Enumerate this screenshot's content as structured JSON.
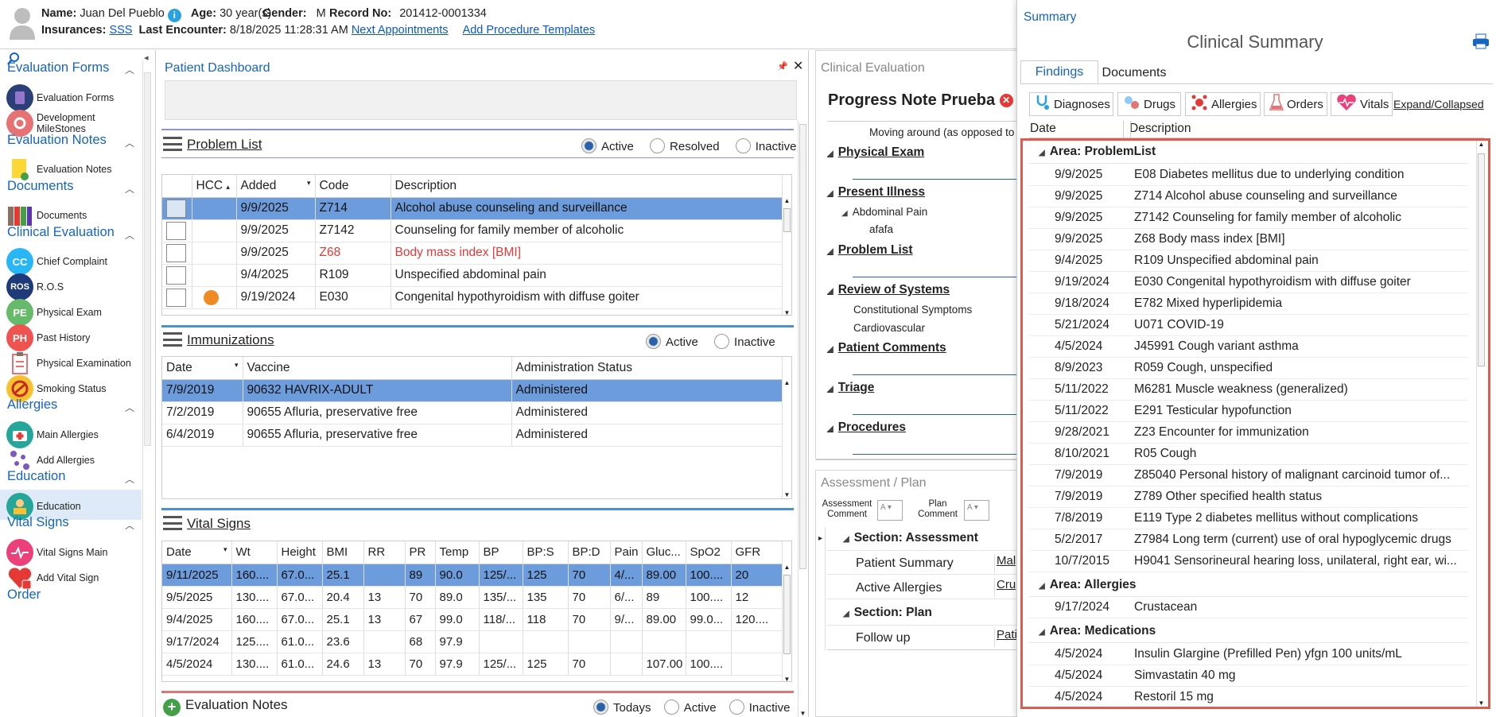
{
  "header": {
    "name_label": "Name:",
    "name": "Juan Del Pueblo",
    "age_label": "Age:",
    "age": "30 year(s)",
    "gender_label": "Gender:",
    "gender": "M",
    "record_label": "Record No:",
    "record": "201412-0001334",
    "insurances_label": "Insurances:",
    "insurance": "SSS",
    "last_encounter_label": "Last Encounter:",
    "last_encounter": "8/18/2025 11:28:31 AM",
    "next_appointments": "Next Appointments",
    "add_procedure_templates": "Add Procedure Templates"
  },
  "sidebar": {
    "sections": [
      {
        "title": "Evaluation Forms",
        "items": [
          "Evaluation Forms",
          "Development MileStones"
        ]
      },
      {
        "title": "Evaluation Notes",
        "items": [
          "Evaluation Notes"
        ]
      },
      {
        "title": "Documents",
        "items": [
          "Documents"
        ]
      },
      {
        "title": "Clinical Evaluation",
        "items": [
          "Chief Complaint",
          "R.O.S",
          "Physical Exam",
          "Past History",
          "Physical Examination",
          "Smoking Status"
        ]
      },
      {
        "title": "Allergies",
        "items": [
          "Main Allergies",
          "Add Allergies"
        ]
      },
      {
        "title": "Education",
        "items": [
          "Education"
        ]
      },
      {
        "title": "Vital Signs",
        "items": [
          "Vital Signs Main",
          "Add Vital Sign"
        ]
      },
      {
        "title": "Order",
        "items": []
      }
    ],
    "icon_text": {
      "cc": "CC",
      "ros": "ROS",
      "pe": "PE",
      "ph": "PH"
    }
  },
  "dashboard": {
    "title": "Patient Dashboard",
    "problem_list": {
      "title": "Problem List",
      "filters": [
        "Active",
        "Resolved",
        "Inactive"
      ],
      "columns": [
        "HCC",
        "Added",
        "Code",
        "Description"
      ],
      "rows": [
        {
          "added": "9/9/2025",
          "code": "Z714",
          "desc": "Alcohol abuse counseling and surveillance"
        },
        {
          "added": "9/9/2025",
          "code": "Z7142",
          "desc": "Counseling for family member of alcoholic"
        },
        {
          "added": "9/9/2025",
          "code": "Z68",
          "desc": "Body mass index [BMI]"
        },
        {
          "added": "9/4/2025",
          "code": "R109",
          "desc": "Unspecified abdominal pain"
        },
        {
          "added": "9/19/2024",
          "code": "E030",
          "desc": "Congenital hypothyroidism with diffuse goiter"
        }
      ]
    },
    "immunizations": {
      "title": "Immunizations",
      "filters": [
        "Active",
        "Inactive"
      ],
      "columns": [
        "Date",
        "Vaccine",
        "Administration Status"
      ],
      "rows": [
        [
          "7/9/2019",
          "90632 HAVRIX-ADULT",
          "Administered"
        ],
        [
          "7/2/2019",
          "90655 Afluria, preservative free",
          "Administered"
        ],
        [
          "6/4/2019",
          "90655 Afluria, preservative free",
          "Administered"
        ]
      ]
    },
    "vitals": {
      "title": "Vital Signs",
      "columns": [
        "Date",
        "Wt",
        "Height",
        "BMI",
        "RR",
        "PR",
        "Temp",
        "BP",
        "BP:S",
        "BP:D",
        "Pain",
        "Gluc...",
        "SpO2",
        "GFR"
      ],
      "rows": [
        [
          "9/11/2025",
          "160....",
          "67.0...",
          "25.1",
          "",
          "89",
          "90.0",
          "125/...",
          "125",
          "70",
          "4/...",
          "89.00",
          "100....",
          "20"
        ],
        [
          "9/5/2025",
          "130....",
          "67.0...",
          "20.4",
          "13",
          "70",
          "89.0",
          "135/...",
          "135",
          "70",
          "6/...",
          "89",
          "100....",
          "12"
        ],
        [
          "9/4/2025",
          "160....",
          "67.0...",
          "25.1",
          "13",
          "67",
          "99.0",
          "118/...",
          "118",
          "70",
          "9/...",
          "89.00",
          "99.0...",
          "120...."
        ],
        [
          "9/17/2024",
          "125....",
          "61.0...",
          "23.6",
          "",
          "68",
          "97.9",
          "",
          "",
          "",
          "",
          "",
          "",
          ""
        ],
        [
          "4/5/2024",
          "130....",
          "61.0...",
          "24.6",
          "13",
          "70",
          "97.9",
          "125/...",
          "125",
          "70",
          "",
          "107.00",
          "100....",
          ""
        ]
      ]
    },
    "evaluation_notes": {
      "title": "Evaluation Notes",
      "filters": [
        "Todays",
        "Active",
        "Inactive"
      ]
    }
  },
  "clinical_eval": {
    "title": "Clinical Evaluation",
    "note_title": "Progress Note Prueba",
    "moving_text": "Moving around (as opposed to",
    "sections": [
      "Physical Exam",
      "Present Illness",
      "Problem List",
      "Review of Systems",
      "Patient Comments",
      "Triage",
      "Procedures"
    ],
    "present_illness_sub": "Abdominal Pain",
    "present_illness_subsub": "afafa",
    "ros_items": [
      "Constitutional Symptoms",
      "Cardiovascular"
    ]
  },
  "assessment": {
    "title": "Assessment / Plan",
    "assessment_comment": "Assessment Comment",
    "plan_comment": "Plan Comment",
    "section_assessment": "Section: Assessment",
    "patient_summary": "Patient Summary",
    "patient_summary_val": "Mal",
    "active_allergies": "Active Allergies",
    "active_allergies_val": "Cru",
    "section_plan": "Section: Plan",
    "follow_up": "Follow up",
    "follow_up_val": "Pati"
  },
  "summary": {
    "title": "Summary",
    "heading": "Clinical Summary",
    "tabs": [
      "Findings",
      "Documents"
    ],
    "tools": [
      "Diagnoses",
      "Drugs",
      "Allergies",
      "Orders",
      "Vitals"
    ],
    "expand": "Expand/Collapsed",
    "columns": [
      "Date",
      "Description"
    ],
    "area_problem": "Area: ProblemList",
    "problems": [
      [
        "9/9/2025",
        "E08 Diabetes mellitus due to underlying condition"
      ],
      [
        "9/9/2025",
        "Z714 Alcohol abuse counseling and surveillance"
      ],
      [
        "9/9/2025",
        "Z7142 Counseling for family member of alcoholic"
      ],
      [
        "9/9/2025",
        "Z68 Body mass index [BMI]"
      ],
      [
        "9/4/2025",
        "R109 Unspecified abdominal pain"
      ],
      [
        "9/19/2024",
        "E030 Congenital hypothyroidism with diffuse goiter"
      ],
      [
        "9/18/2024",
        "E782 Mixed hyperlipidemia"
      ],
      [
        "5/21/2024",
        "U071 COVID-19"
      ],
      [
        "4/5/2024",
        "J45991 Cough variant asthma"
      ],
      [
        "8/9/2023",
        "R059 Cough, unspecified"
      ],
      [
        "5/11/2022",
        "M6281 Muscle weakness (generalized)"
      ],
      [
        "5/11/2022",
        "E291 Testicular hypofunction"
      ],
      [
        "9/28/2021",
        "Z23 Encounter for immunization"
      ],
      [
        "8/10/2021",
        "R05 Cough"
      ],
      [
        "7/9/2019",
        "Z85040 Personal history of malignant carcinoid tumor of..."
      ],
      [
        "7/9/2019",
        "Z789 Other specified health status"
      ],
      [
        "7/8/2019",
        "E119 Type 2 diabetes mellitus without complications"
      ],
      [
        "5/2/2017",
        "Z7984 Long term (current) use of oral hypoglycemic drugs"
      ],
      [
        "10/7/2015",
        "H9041 Sensorineural hearing loss, unilateral, right ear, wi..."
      ]
    ],
    "area_allergies": "Area: Allergies",
    "allergies": [
      [
        "9/17/2024",
        "Crustacean"
      ]
    ],
    "area_medications": "Area: Medications",
    "medications": [
      [
        "4/5/2024",
        "Insulin Glargine (Prefilled Pen) yfgn 100 units/mL"
      ],
      [
        "4/5/2024",
        "Simvastatin 40 mg"
      ],
      [
        "4/5/2024",
        "Restoril 15 mg"
      ]
    ]
  },
  "colors": {
    "accent": "#1565c0",
    "selection": "#6c9cdc",
    "red_frame": "#e05a50",
    "alert": "#e53935"
  }
}
